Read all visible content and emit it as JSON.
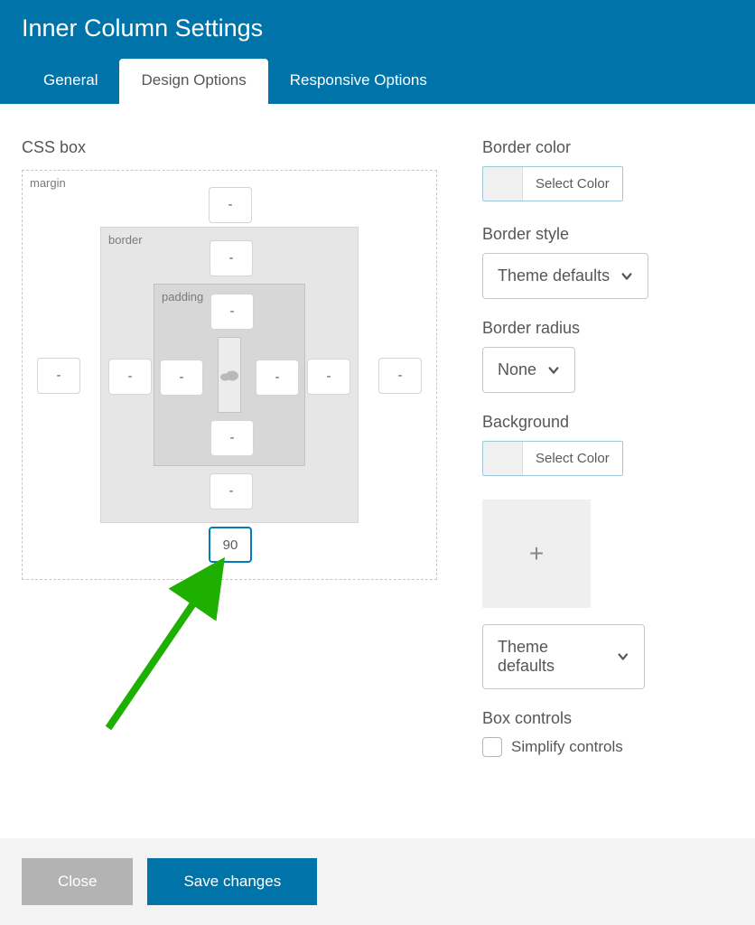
{
  "title": "Inner Column Settings",
  "tabs": [
    "General",
    "Design Options",
    "Responsive Options"
  ],
  "active_tab": 1,
  "css_box_label": "CSS box",
  "labels": {
    "margin": "margin",
    "border": "border",
    "padding": "padding"
  },
  "margin": {
    "top": "-",
    "right": "-",
    "bottom": "90",
    "left": "-"
  },
  "border": {
    "top": "-",
    "right": "-",
    "bottom": "-",
    "left": "-"
  },
  "padding": {
    "top": "-",
    "right": "-",
    "bottom": "-",
    "left": "-"
  },
  "right_panel": {
    "border_color": {
      "label": "Border color",
      "btn": "Select Color"
    },
    "border_style": {
      "label": "Border style",
      "value": "Theme defaults"
    },
    "border_radius": {
      "label": "Border radius",
      "value": "None"
    },
    "background": {
      "label": "Background",
      "btn": "Select Color"
    },
    "bg_select": "Theme defaults",
    "box_controls": {
      "label": "Box controls",
      "checkbox": "Simplify controls"
    }
  },
  "footer": {
    "close": "Close",
    "save": "Save changes"
  }
}
